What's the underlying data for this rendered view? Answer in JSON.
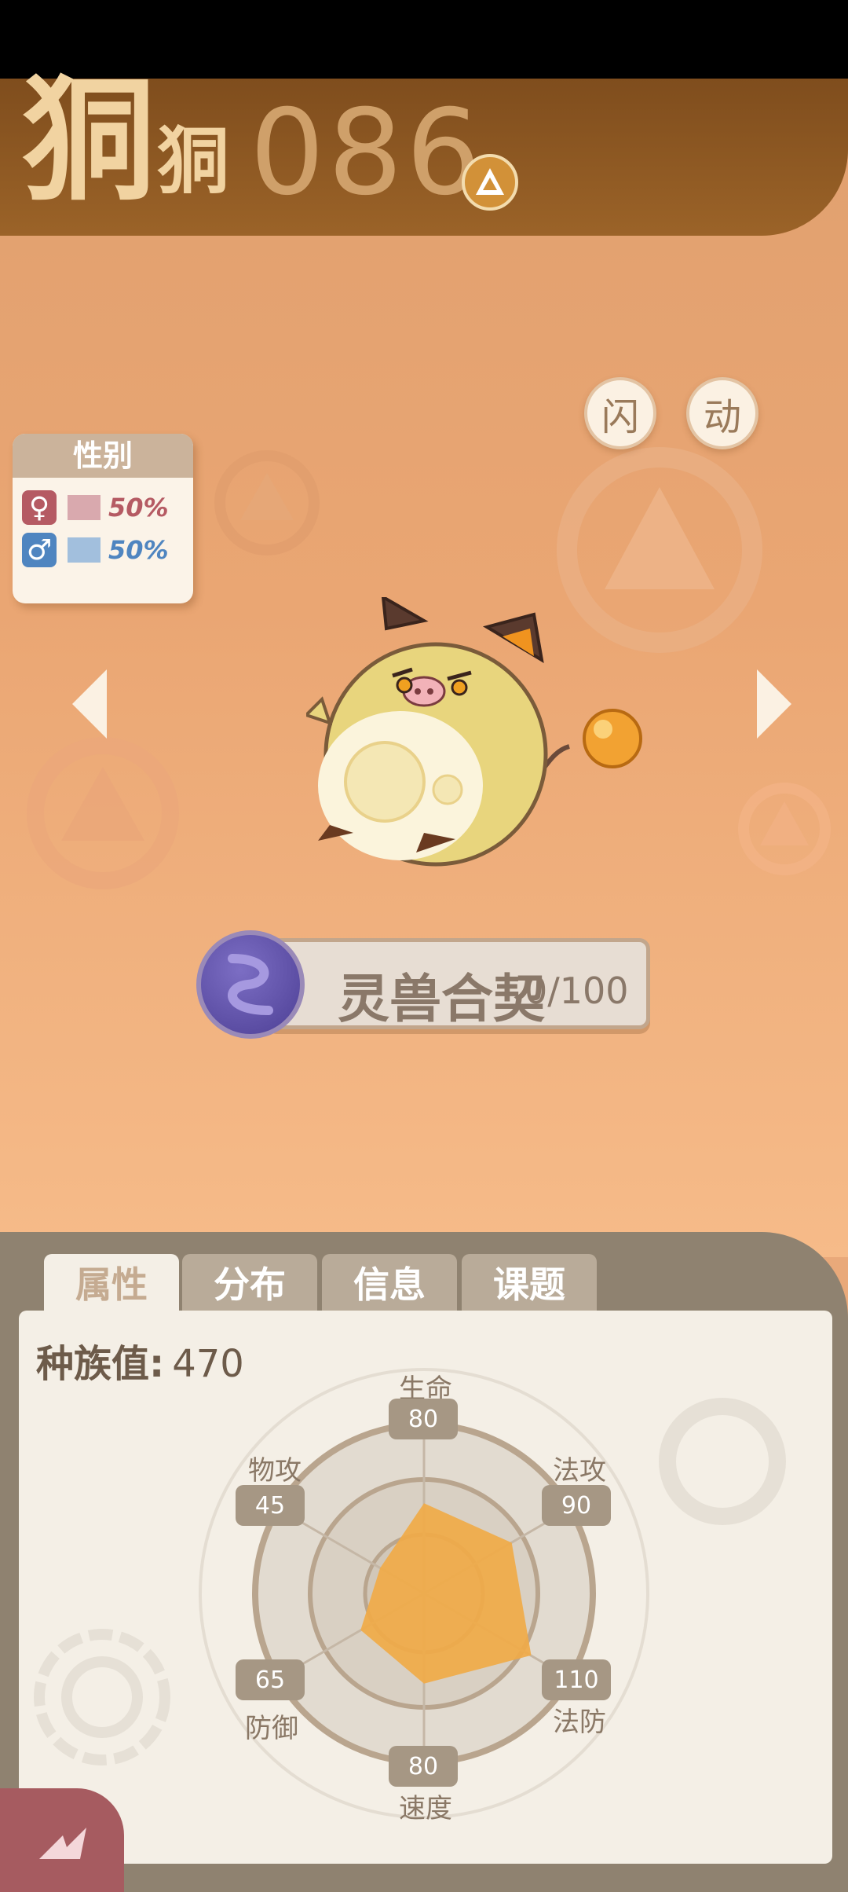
{
  "header": {
    "title_large": "狪",
    "title_small": "狪",
    "number": "086",
    "type_icon": "triangle-type-icon"
  },
  "actions": {
    "shiny_label": "闪",
    "animate_label": "动"
  },
  "gender": {
    "header": "性别",
    "female": {
      "symbol": "♀",
      "percent": "50%",
      "color": "#b55a63"
    },
    "male": {
      "symbol": "♂",
      "percent": "50%",
      "color": "#4f85c0"
    }
  },
  "pact": {
    "label": "灵兽合契",
    "count": "0/100"
  },
  "tabs": [
    {
      "label": "属性",
      "active": true
    },
    {
      "label": "分布",
      "active": false
    },
    {
      "label": "信息",
      "active": false
    },
    {
      "label": "课题",
      "active": false
    }
  ],
  "stats": {
    "total_label": "种族值:",
    "total_value": "470",
    "items": [
      {
        "label": "生命",
        "value": "80"
      },
      {
        "label": "法攻",
        "value": "90"
      },
      {
        "label": "法防",
        "value": "110"
      },
      {
        "label": "速度",
        "value": "80"
      },
      {
        "label": "防御",
        "value": "65"
      },
      {
        "label": "物攻",
        "value": "45"
      }
    ]
  },
  "colors": {
    "header": "#8a5522",
    "accent_orange": "#f0aa48",
    "panel": "#8f8270"
  }
}
